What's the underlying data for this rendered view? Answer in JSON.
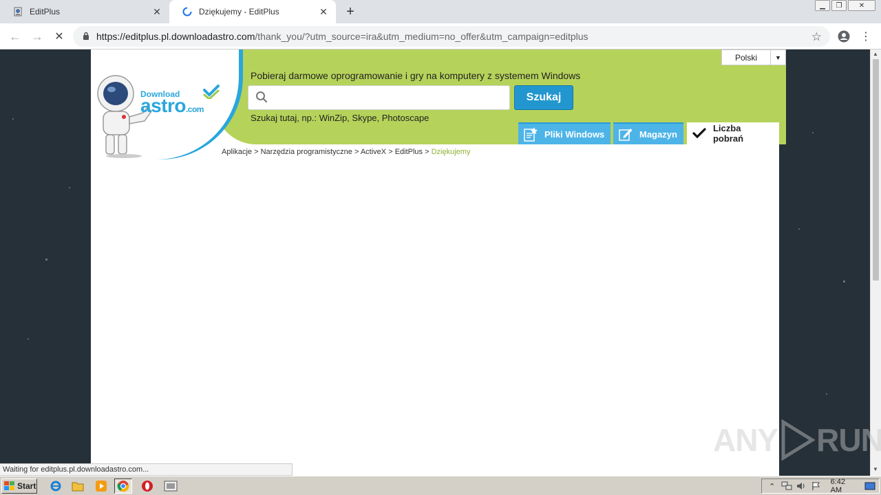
{
  "browser": {
    "tabs": [
      {
        "title": "EditPlus",
        "active": false
      },
      {
        "title": "Dziękujemy - EditPlus",
        "active": true
      }
    ],
    "url_host": "https://editplus.pl.downloadastro.com",
    "url_rest": "/thank_you/?utm_source=ira&utm_medium=no_offer&utm_campaign=editplus",
    "status_text": "Waiting for editplus.pl.downloadastro.com..."
  },
  "site": {
    "logo_download": "Download",
    "logo_astro": "astro",
    "logo_tld": ".com",
    "tagline": "Pobieraj darmowe oprogramowanie i gry na komputery z systemem Windows",
    "search_value": "",
    "search_button": "Szukaj",
    "search_hint": "Szukaj tutaj, np.: WinZip, Skype, Photoscape",
    "language": "Polski",
    "nav": [
      {
        "label": "Pliki Windows"
      },
      {
        "label": "Magazyn"
      },
      {
        "label": "Liczba pobrań"
      }
    ],
    "breadcrumb": [
      {
        "label": "Aplikacje"
      },
      {
        "label": "Narzędzia programistyczne"
      },
      {
        "label": "ActiveX"
      },
      {
        "label": "EditPlus"
      },
      {
        "label": "Dziękujemy"
      }
    ],
    "breadcrumb_sep": ">"
  },
  "watermark": {
    "left": "ANY",
    "right": "RUN"
  },
  "taskbar": {
    "start": "Start",
    "clock": "6:42 AM"
  },
  "colors": {
    "header_green": "#b5d35a",
    "brand_blue": "#2aa6dd",
    "button_blue": "#2196cf",
    "breadcrumb_current": "#8fb030"
  }
}
